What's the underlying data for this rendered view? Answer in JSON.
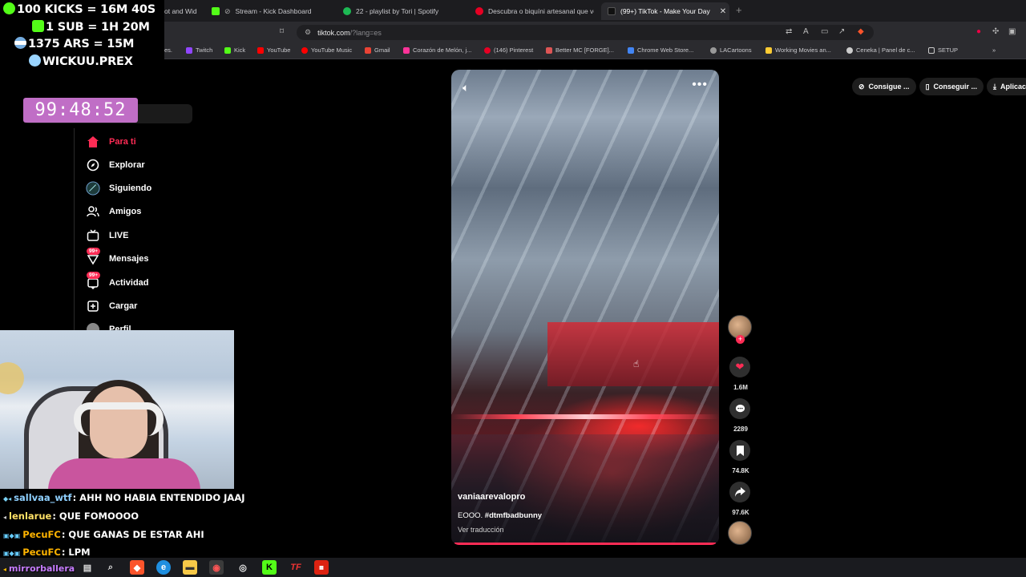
{
  "browser": {
    "tabs": [
      {
        "label": "ot and Wid"
      },
      {
        "label": "Stream - Kick Dashboard"
      },
      {
        "label": "22 - playlist by Tori | Spotify"
      },
      {
        "label": "Descubra o biquíni artesanal que ver"
      },
      {
        "label": "(99+) TikTok - Make Your Day"
      }
    ],
    "url_host": "tiktok.com",
    "url_rest": "/?lang=es",
    "bookmarks": [
      "es.",
      "Twitch",
      "Kick",
      "YouTube",
      "YouTube Music",
      "Gmail",
      "Corazón de Melón, j...",
      "(146) Pinterest",
      "Better MC [FORGE]...",
      "Chrome Web Store...",
      "LACartoons",
      "Working Movies an...",
      "Ceneka | Panel de c...",
      "SETUP"
    ]
  },
  "overlay": {
    "stats": [
      "100 KICKS = 16M 40S",
      "1 SUB = 1H 20M",
      "1375 ARS = 15M",
      "WICKUU.PREX"
    ],
    "timer": "99:48:52"
  },
  "sidebar": {
    "items": [
      {
        "label": "Para ti"
      },
      {
        "label": "Explorar"
      },
      {
        "label": "Siguiendo"
      },
      {
        "label": "Amigos"
      },
      {
        "label": "LIVE"
      },
      {
        "label": "Mensajes",
        "badge": "99+"
      },
      {
        "label": "Actividad",
        "badge": "99+"
      },
      {
        "label": "Cargar"
      },
      {
        "label": "Perfil"
      }
    ]
  },
  "chat": [
    {
      "user": "sallvaa_wtf",
      "text": ": AHH NO HABIA ENTENDIDO JAAJ",
      "color": "#8fd0ff"
    },
    {
      "user": "lenlarue",
      "text": ": QUE FOMOOOO",
      "color": "#ffe066"
    },
    {
      "user": "PecuFC",
      "text": ": QUE GANAS DE ESTAR AHI",
      "color": "#ffb400"
    },
    {
      "user": "PecuFC",
      "text": ": LPM",
      "color": "#ffb400"
    },
    {
      "user": "mirrorballera",
      "text": "",
      "color": "#c77dff"
    }
  ],
  "video": {
    "username": "vaniaarevalopro",
    "caption": "EOOO. ",
    "hashtag": "#dtmfbadbunny",
    "translate": "Ver traducción",
    "likes": "1.6M",
    "comments": "2289",
    "saves": "74.8K",
    "shares": "97.6K"
  },
  "topbuttons": [
    "Consigue ...",
    "Conseguir ...",
    "Aplicac"
  ],
  "colors": {
    "accent": "#fe2c55",
    "timer": "#c06ec6"
  }
}
